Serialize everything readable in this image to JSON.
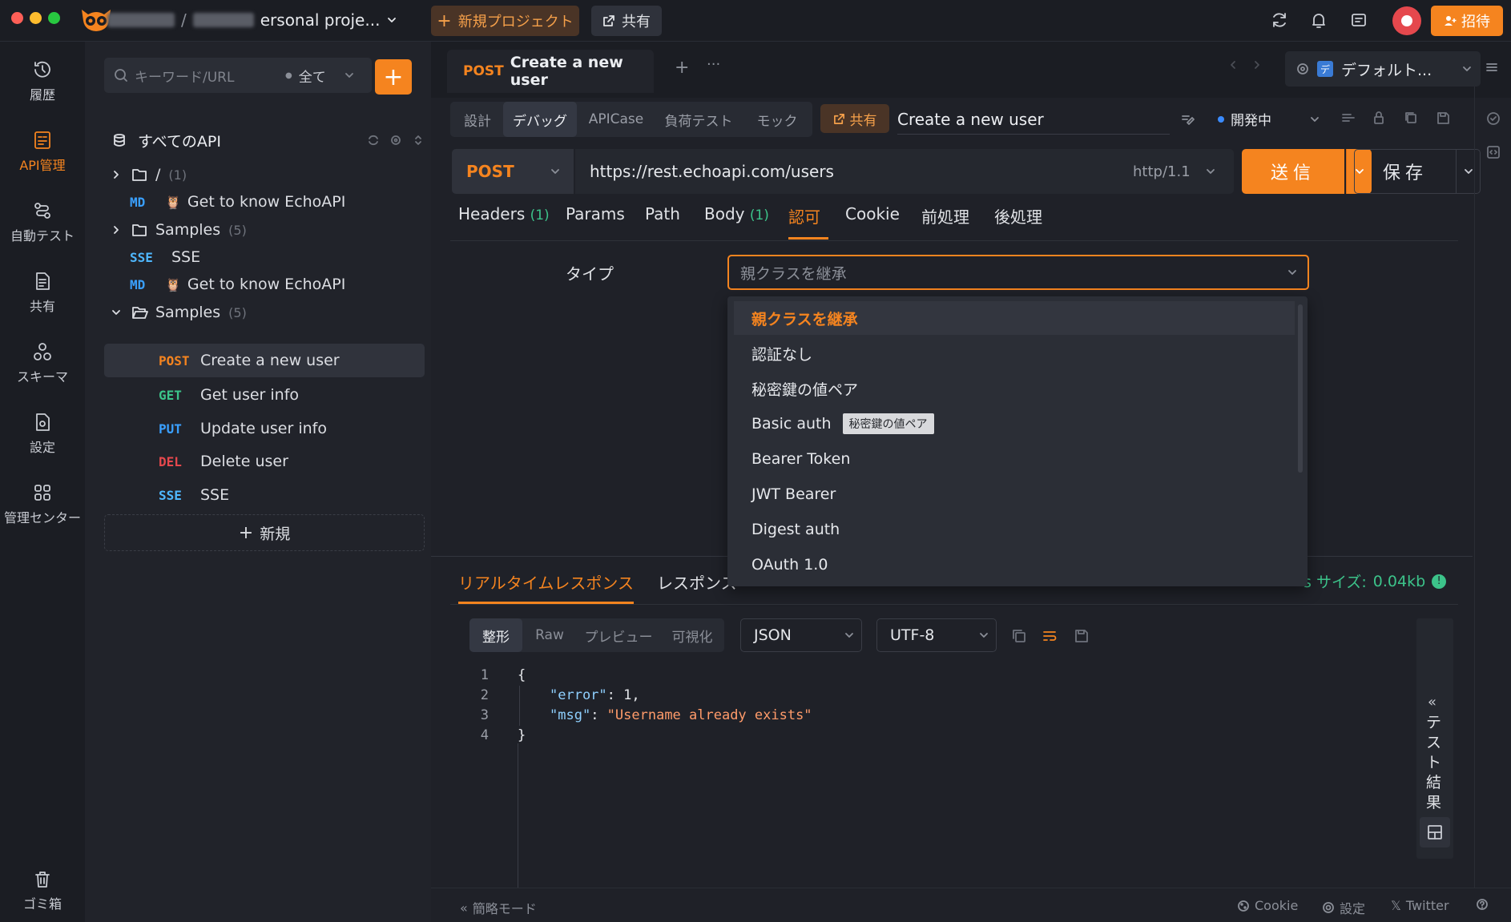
{
  "titlebar": {
    "project_suffix": "ersonal proje...",
    "new_project": "新規プロジェクト",
    "share": "共有",
    "invite": "招待"
  },
  "leftnav": [
    {
      "label": "履歴",
      "icon": "history-icon"
    },
    {
      "label": "API管理",
      "icon": "api-icon",
      "active": true
    },
    {
      "label": "自動テスト",
      "icon": "auto-test-icon"
    },
    {
      "label": "共有",
      "icon": "share-doc-icon"
    },
    {
      "label": "スキーマ",
      "icon": "schema-icon"
    },
    {
      "label": "設定",
      "icon": "settings-icon"
    },
    {
      "label": "管理センター",
      "icon": "admin-icon"
    },
    {
      "label": "ゴミ箱",
      "icon": "trash-icon"
    }
  ],
  "apipanel": {
    "search_placeholder": "キーワード/URL",
    "filter": "全て",
    "all_apis": "すべてのAPI",
    "new": "新規",
    "tree": [
      {
        "type": "folder",
        "label": "/",
        "count": "(1)",
        "expanded": false
      },
      {
        "method": "MD",
        "label": "Get to know EchoAPI"
      },
      {
        "type": "folder",
        "label": "Samples",
        "count": "(5)",
        "expanded": false
      },
      {
        "method": "SSE",
        "label": "SSE"
      },
      {
        "method": "MD",
        "label": "Get to know EchoAPI"
      },
      {
        "type": "folder",
        "label": "Samples",
        "count": "(5)",
        "expanded": true
      },
      {
        "method": "POST",
        "label": "Create a new user",
        "selected": true
      },
      {
        "method": "GET",
        "label": "Get user info"
      },
      {
        "method": "PUT",
        "label": "Update user info"
      },
      {
        "method": "DEL",
        "label": "Delete user"
      },
      {
        "method": "SSE",
        "label": "SSE"
      }
    ]
  },
  "tab": {
    "method": "POST",
    "title": "Create a new user"
  },
  "env": "デフォルト...",
  "modes": [
    "設計",
    "デバッグ",
    "APICase",
    "負荷テスト",
    "モック"
  ],
  "share_tag": "共有",
  "request_name": "Create a new user",
  "status": "開発中",
  "request": {
    "method": "POST",
    "url": "https://rest.echoapi.com/users",
    "protocol": "http/1.1",
    "send": "送信",
    "save": "保存"
  },
  "subtabs": [
    {
      "label": "Headers",
      "count": "(1)"
    },
    {
      "label": "Params",
      "count": ""
    },
    {
      "label": "Path",
      "count": ""
    },
    {
      "label": "Body",
      "count": "(1)"
    },
    {
      "label": "認可",
      "count": "",
      "active": true
    },
    {
      "label": "Cookie",
      "count": ""
    },
    {
      "label": "前処理",
      "count": ""
    },
    {
      "label": "後処理",
      "count": ""
    }
  ],
  "auth": {
    "type_label": "タイプ",
    "selected": "親クラスを継承",
    "options": [
      "親クラスを継承",
      "認証なし",
      "秘密鍵の値ペア",
      "Basic auth",
      "Bearer Token",
      "JWT Bearer",
      "Digest auth",
      "OAuth 1.0"
    ],
    "tooltip": "秘密鍵の値ペア"
  },
  "response": {
    "tab_realtime": "リアルタイムレスポンス",
    "tab_response": "レスポンス",
    "size_label": "s サイズ:",
    "size_value": "0.04kb",
    "formats": [
      "整形",
      "Raw",
      "プレビュー",
      "可視化"
    ],
    "lang": "JSON",
    "encoding": "UTF-8",
    "code_lines": [
      {
        "n": "1",
        "text": "{"
      },
      {
        "n": "2",
        "key": "\"error\"",
        "value": " 1,"
      },
      {
        "n": "3",
        "key": "\"msg\"",
        "string": "\"Username already exists\""
      },
      {
        "n": "4",
        "text": "}"
      }
    ],
    "test_results": "テスト結果"
  },
  "bottombar": {
    "simple_mode": "簡略モード",
    "cookie": "Cookie",
    "settings": "設定",
    "twitter": "Twitter"
  },
  "colors": {
    "accent": "#f5841f",
    "get": "#3cc38a",
    "put": "#3aa0ff",
    "del": "#e5484d",
    "md": "#3aa0ff",
    "sse": "#4fb8ff"
  }
}
